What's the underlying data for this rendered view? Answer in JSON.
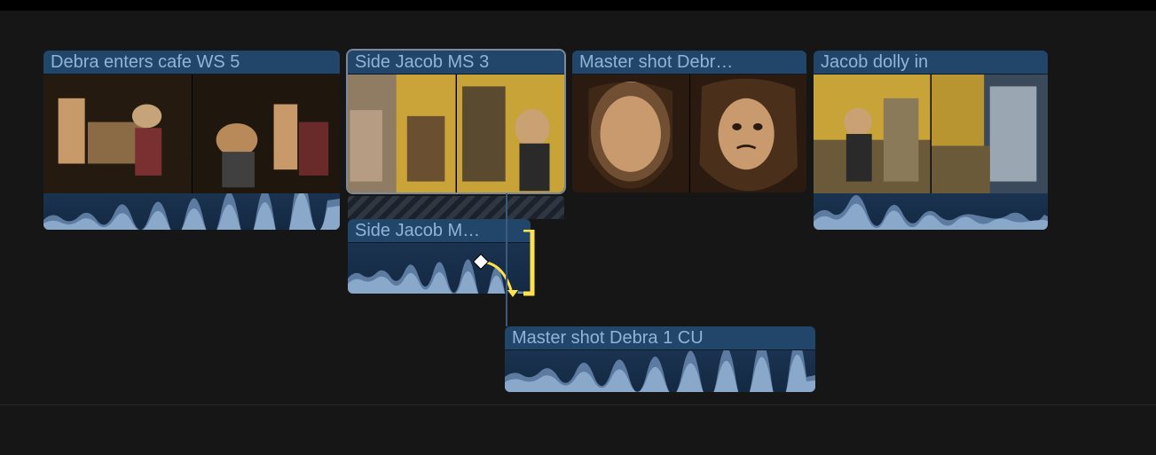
{
  "timeline": {
    "clips": [
      {
        "id": "clip1",
        "label": "Debra enters cafe WS 5"
      },
      {
        "id": "clip2",
        "label": "Side Jacob MS 3"
      },
      {
        "id": "clip3",
        "label": "Master shot Debr…"
      },
      {
        "id": "clip4",
        "label": "Jacob dolly in"
      }
    ],
    "detached_audio": {
      "label": "Side Jacob M…"
    },
    "connected_audio": {
      "label": "Master shot Debra 1 CU"
    }
  }
}
